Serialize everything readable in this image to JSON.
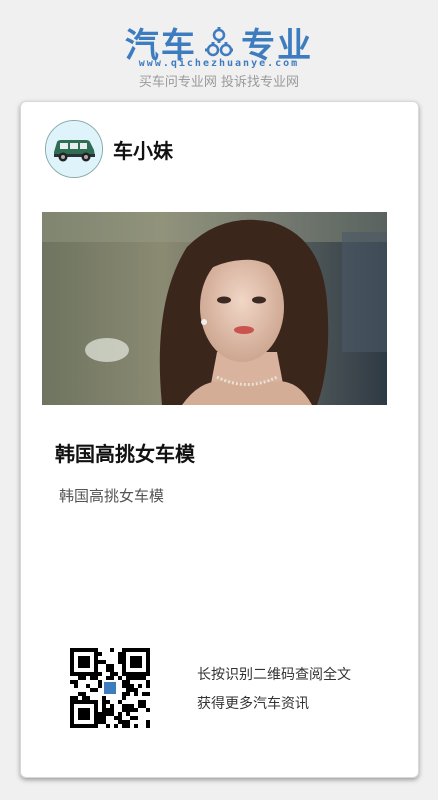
{
  "header": {
    "logo_left": "汽车",
    "logo_right": "专业",
    "domain": "www.qichezhuanye.com",
    "slogan": "买车问专业网 投诉找专业网"
  },
  "author": {
    "name": "车小妹"
  },
  "article": {
    "title": "韩国高挑女车模",
    "description": "韩国高挑女车模"
  },
  "qr": {
    "line1": "长按识别二维码查阅全文",
    "line2": "获得更多汽车资讯"
  },
  "colors": {
    "brand": "#3e7cc0",
    "background": "#f0f0f0"
  }
}
